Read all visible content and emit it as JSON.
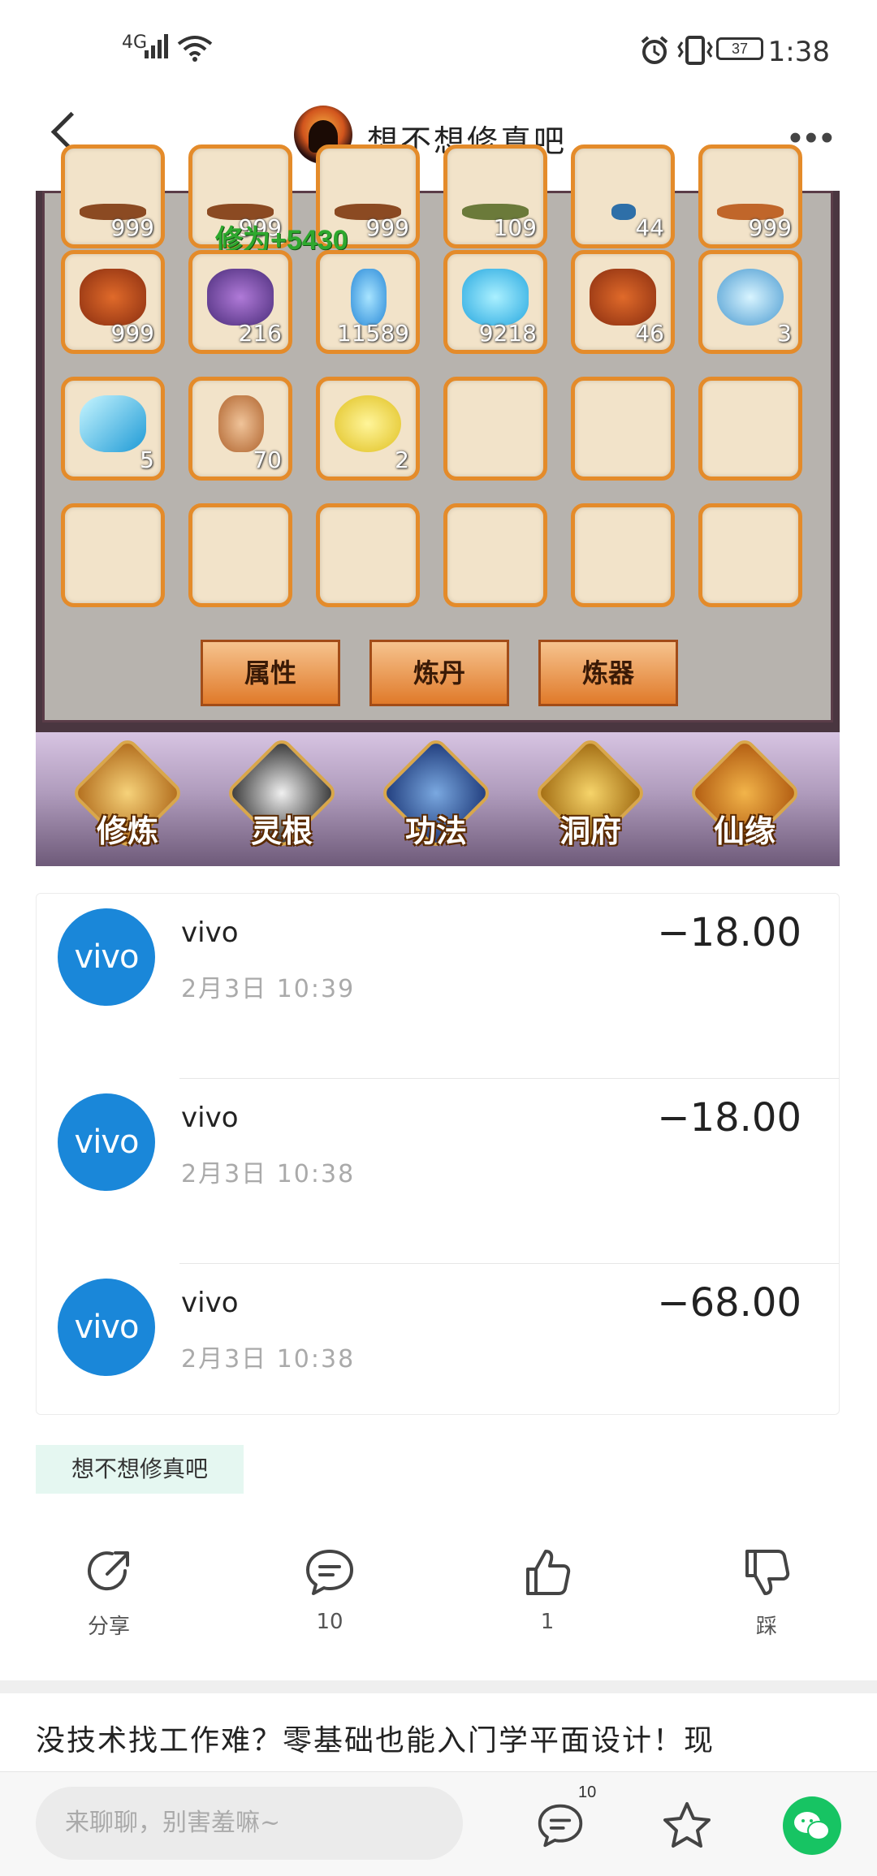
{
  "status_bar": {
    "network": "4G",
    "battery": "37",
    "time": "1:38"
  },
  "header": {
    "title": "想不想修真吧"
  },
  "game": {
    "gain_text": "修为+5430",
    "row0_counts": [
      "999",
      "999",
      "999",
      "109",
      "44",
      "999"
    ],
    "row1_counts": [
      "999",
      "216",
      "11589",
      "9218",
      "46",
      "3"
    ],
    "row2_counts": [
      "5",
      "70",
      "2"
    ],
    "buttons": [
      "属性",
      "炼丹",
      "炼器"
    ],
    "menu": [
      "修炼",
      "灵根",
      "功法",
      "洞府",
      "仙缘"
    ]
  },
  "transactions": [
    {
      "name": "vivo",
      "logo_text": "vivo",
      "date": "2月3日 10:39",
      "amount": "−18.00"
    },
    {
      "name": "vivo",
      "logo_text": "vivo",
      "date": "2月3日 10:38",
      "amount": "−18.00"
    },
    {
      "name": "vivo",
      "logo_text": "vivo",
      "date": "2月3日 10:38",
      "amount": "−68.00"
    }
  ],
  "tag": "想不想修真吧",
  "actions": {
    "share": "分享",
    "comments": "10",
    "likes": "1",
    "dislike": "踩"
  },
  "promo_text": "没技术找工作难？零基础也能入门学平面设计！现",
  "bottom_bar": {
    "input_placeholder": "来聊聊，别害羞嘛~",
    "comment_count": "10"
  },
  "colors": {
    "accent_green": "#17c463",
    "tag_bg": "#e5f7f1",
    "vivo_blue": "#1a87d9",
    "slot_border": "#e48b2a"
  }
}
